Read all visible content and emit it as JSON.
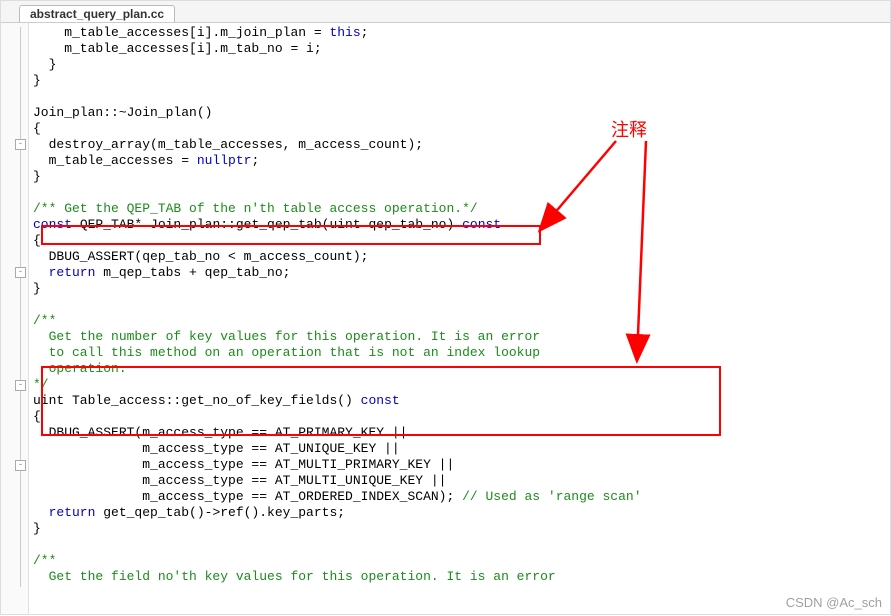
{
  "tab": {
    "filename": "abstract_query_plan.cc"
  },
  "annotation": {
    "label": "注释"
  },
  "watermark": "CSDN @Ac_sch",
  "code": {
    "l1": "    m_table_accesses[i].m_join_plan = ",
    "l1_kw": "this",
    "l1_end": ";",
    "l2": "    m_table_accesses[i].m_tab_no = i;",
    "l3": "  }",
    "l4": "}",
    "l5": "",
    "l6": "Join_plan::~Join_plan()",
    "l7": "{",
    "l8": "  destroy_array(m_table_accesses, m_access_count);",
    "l9": "  m_table_accesses = ",
    "l9_kw": "nullptr",
    "l9_end": ";",
    "l10": "}",
    "l11": "",
    "l12_cmt": "/** Get the QEP_TAB of the n'th table access operation.*/",
    "l13_kw1": "const",
    "l13_mid": " QEP_TAB* Join_plan::get_qep_tab(uint qep_tab_no) ",
    "l13_kw2": "const",
    "l14": "{",
    "l15": "  DBUG_ASSERT(qep_tab_no < m_access_count);",
    "l16_kw": "  return",
    "l16_end": " m_qep_tabs + qep_tab_no;",
    "l17": "}",
    "l18": "",
    "l19_cmt": "/**",
    "l20_cmt": "  Get the number of key values for this operation. It is an error",
    "l21_cmt": "  to call this method on an operation that is not an index lookup",
    "l22_cmt": "  operation.",
    "l23_cmt": "*/",
    "l24": "uint Table_access::get_no_of_key_fields() ",
    "l24_kw": "const",
    "l25": "{",
    "l26": "  DBUG_ASSERT(m_access_type == AT_PRIMARY_KEY ||",
    "l27": "              m_access_type == AT_UNIQUE_KEY ||",
    "l28": "              m_access_type == AT_MULTI_PRIMARY_KEY ||",
    "l29": "              m_access_type == AT_MULTI_UNIQUE_KEY ||",
    "l30": "              m_access_type == AT_ORDERED_INDEX_SCAN); ",
    "l30_cmt": "// Used as 'range scan'",
    "l31_kw": "  return",
    "l31_end": " get_qep_tab()->ref().key_parts;",
    "l32": "}",
    "l33": "",
    "l34_cmt": "/**",
    "l35_cmt": "  Get the field no'th key values for this operation. It is an error"
  }
}
